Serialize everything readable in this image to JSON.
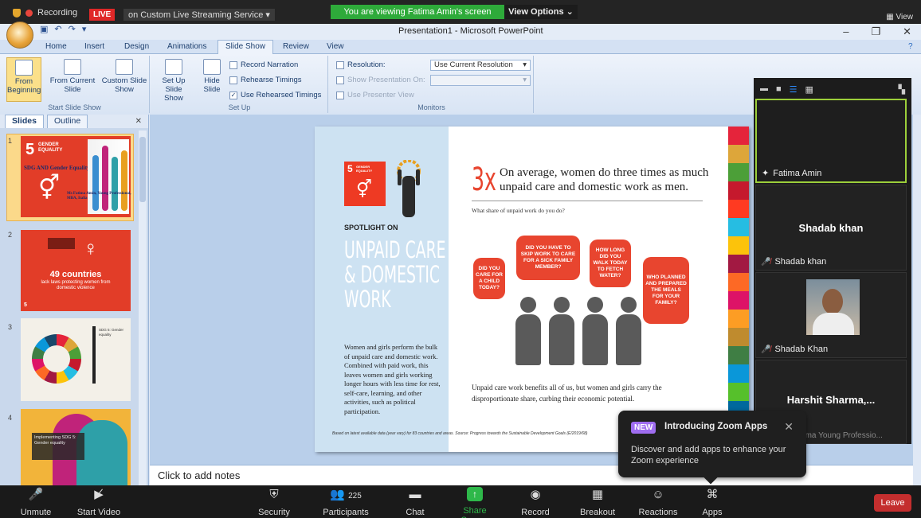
{
  "zoom_top": {
    "recording": "Recording",
    "live": "LIVE",
    "stream_service": "on Custom Live Streaming Service",
    "viewing_banner": "You are viewing Fatima Amin's screen",
    "view_options": "View Options",
    "view": "View"
  },
  "ppt": {
    "window_title": "Presentation1 - Microsoft PowerPoint",
    "tabs": [
      "Home",
      "Insert",
      "Design",
      "Animations",
      "Slide Show",
      "Review",
      "View"
    ],
    "active_tab": "Slide Show",
    "ribbon": {
      "from_beginning": "From Beginning",
      "from_current": "From Current Slide",
      "custom_show": "Custom Slide Show",
      "group_start": "Start Slide Show",
      "setup_show": "Set Up Slide Show",
      "hide_slide": "Hide Slide",
      "record_narration": "Record Narration",
      "rehearse": "Rehearse Timings",
      "use_rehearsed": "Use Rehearsed Timings",
      "group_setup": "Set Up",
      "resolution_label": "Resolution:",
      "resolution_value": "Use Current Resolution",
      "show_on": "Show Presentation On:",
      "presenter_view": "Use Presenter View",
      "group_monitors": "Monitors"
    },
    "pane_tabs": [
      "Slides",
      "Outline"
    ],
    "thumbs": [
      {
        "num": "1",
        "title": "SDG AND Gender Equality",
        "byline": "Ms Fatima Amin, Young Professional, MBA, Italia"
      },
      {
        "num": "2",
        "headline": "49 countries",
        "sub": "lack laws protecting women from domestic violence"
      },
      {
        "num": "3",
        "title": "SDG 5: Gender equality"
      },
      {
        "num": "4",
        "title": "Implementing SDG 5: Gender equality"
      }
    ],
    "notes_placeholder": "Click to add notes"
  },
  "slide": {
    "sdg_number": "5",
    "sdg_label": "GENDER EQUALITY",
    "spotlight": "SPOTLIGHT ON",
    "big_title": [
      "UNPAID CARE",
      "& DOMESTIC",
      "WORK"
    ],
    "left_body": "Women and girls perform the bulk of unpaid care and domestic work. Combined with paid work, this leaves women and girls working longer hours with less time for rest, self-care, learning, and other activities, such as political participation.",
    "stat": "3x",
    "stat_text": "On average, women do three times as much unpaid care and domestic work as men.",
    "question": "What share of unpaid work do you do?",
    "bubbles": [
      "DID YOU CARE FOR A CHILD TODAY?",
      "DID YOU HAVE TO SKIP WORK TO CARE FOR A SICK FAMILY MEMBER?",
      "HOW LONG DID YOU WALK TODAY TO FETCH WATER?",
      "WHO PLANNED AND PREPARED THE MEALS FOR YOUR FAMILY?"
    ],
    "right_body": "Unpaid care work benefits all of us, but women and girls carry the disproportionate share, curbing their economic potential.",
    "footnote": "Based on latest available data (year vary) for 83 countries and areas. Source: Progress towards the Sustainable Development Goals (E/2019/68)",
    "stripe_colors": [
      "#e5243b",
      "#dda63a",
      "#4c9f38",
      "#c5192d",
      "#ff3a21",
      "#26bde2",
      "#fcc30b",
      "#a21942",
      "#fd6925",
      "#dd1367",
      "#fd9d24",
      "#bf8b2e",
      "#3f7e44",
      "#0a97d9",
      "#56c02b",
      "#00689d",
      "#19486a"
    ]
  },
  "zoom_panel": {
    "participants": [
      {
        "name": "Fatima Amin",
        "muted": false
      },
      {
        "name": "Shadab khan",
        "display": "Shadab khan",
        "muted": true
      },
      {
        "name": "Shadab Khan",
        "muted": true
      },
      {
        "name": "Harshit  Sharma,...",
        "sub": "Harshit Sharma Young Professio..."
      }
    ]
  },
  "zoom_apps": {
    "badge": "NEW",
    "title": "Introducing Zoom Apps",
    "desc": "Discover and add apps to enhance your Zoom experience"
  },
  "zoom_bar": {
    "unmute": "Unmute",
    "start_video": "Start Video",
    "security": "Security",
    "participants": "Participants",
    "participant_count": "225",
    "chat": "Chat",
    "share": "Share Screen",
    "record": "Record",
    "breakout": "Breakout Rooms",
    "reactions": "Reactions",
    "apps": "Apps",
    "leave": "Leave"
  }
}
